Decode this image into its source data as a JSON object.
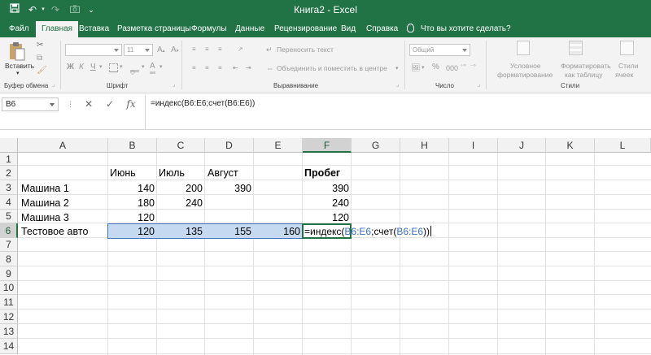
{
  "window": {
    "title": "Книга2  -  Excel"
  },
  "tabs": [
    "Файл",
    "Главная",
    "Вставка",
    "Разметка страницы",
    "Формулы",
    "Данные",
    "Рецензирование",
    "Вид",
    "Справка"
  ],
  "tell_me": "Что вы хотите сделать?",
  "ribbon": {
    "paste_label": "Вставить",
    "clipboard_label": "Буфер обмена",
    "font_group": "Шрифт",
    "font_size": "11",
    "bold": "Ж",
    "italic": "К",
    "underline": "Ч",
    "wrap_text": "Переносить текст",
    "merge_center": "Объединить и поместить в центре",
    "alignment_group": "Выравнивание",
    "number_format": "Общий",
    "number_group": "Число",
    "percent": "%",
    "thousands": "000",
    "cond_format": [
      "Условное",
      "форматирование"
    ],
    "format_table": [
      "Форматировать",
      "как таблицу"
    ],
    "cell_styles": [
      "Стили",
      "ячеек"
    ],
    "styles_group": "Стили"
  },
  "formula_bar": {
    "name_box": "B6",
    "fx": "fx",
    "formula": "=индекс(B6:E6;счет(B6:E6))"
  },
  "columns": [
    "A",
    "B",
    "C",
    "D",
    "E",
    "F",
    "G",
    "H",
    "I",
    "J",
    "K",
    "L"
  ],
  "rows": [
    "1",
    "2",
    "3",
    "4",
    "5",
    "6",
    "7",
    "8",
    "9",
    "10",
    "11",
    "12",
    "13",
    "14"
  ],
  "sheet": {
    "headers": {
      "B2": "Июнь",
      "C2": "Июль",
      "D2": "Август",
      "F2": "Пробег"
    },
    "A3": "Машина 1",
    "B3": "140",
    "C3": "200",
    "D3": "390",
    "F3": "390",
    "A4": "Машина 2",
    "B4": "180",
    "C4": "240",
    "F4": "240",
    "A5": "Машина 3",
    "B5": "120",
    "F5": "120",
    "A6": "Тестовое авто",
    "B6": "120",
    "C6": "135",
    "D6": "155",
    "E6": "160",
    "F6": {
      "p1": "=индекс(",
      "p2": "B6:E6",
      "p3": ";счет(",
      "p4": "B6:E6",
      "p5": "))"
    }
  },
  "colors": {
    "excel_green": "#217346",
    "selection": "#c5d9f1",
    "reference_blue": "#3b6fc8"
  }
}
